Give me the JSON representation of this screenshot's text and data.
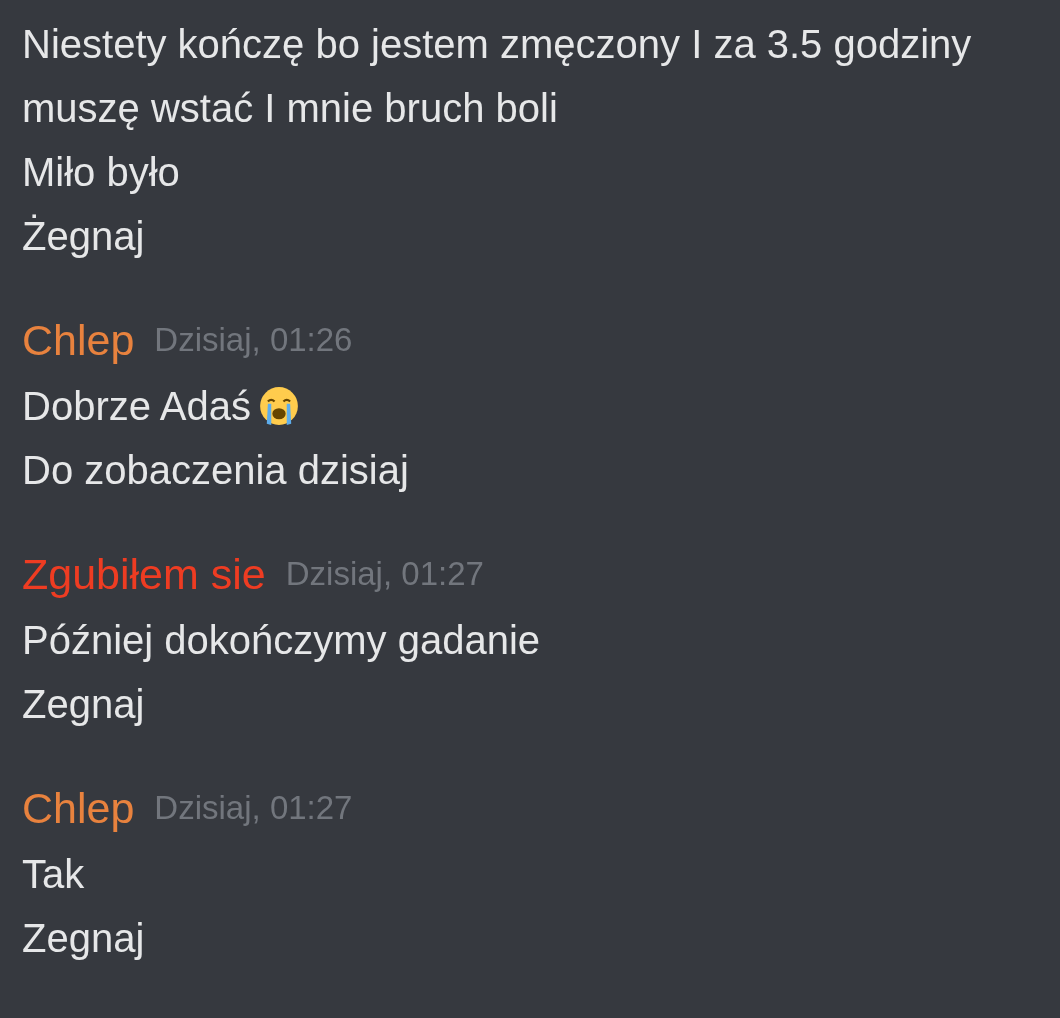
{
  "messages": [
    {
      "lines": [
        {
          "text": "Niestety kończę bo jestem zmęczony I za 3.5 godziny"
        },
        {
          "text": "muszę wstać I mnie bruch boli"
        },
        {
          "text": "Miło było"
        },
        {
          "text": "Żegnaj"
        }
      ]
    },
    {
      "author": "Chlep",
      "color": "#e8823e",
      "time": "Dzisiaj, 01:26",
      "lines": [
        {
          "text": "Dobrze Adaś",
          "emoji": true
        },
        {
          "text": "Do zobaczenia dzisiaj"
        }
      ]
    },
    {
      "author": "Zgubiłem sie",
      "color": "#ee3c22",
      "time": "Dzisiaj, 01:27",
      "lines": [
        {
          "text": "Później dokończymy gadanie"
        },
        {
          "text": "Zegnaj"
        }
      ]
    },
    {
      "author": "Chlep",
      "color": "#e8823e",
      "time": "Dzisiaj, 01:27",
      "lines": [
        {
          "text": "Tak"
        },
        {
          "text": "Zegnaj"
        }
      ]
    }
  ]
}
